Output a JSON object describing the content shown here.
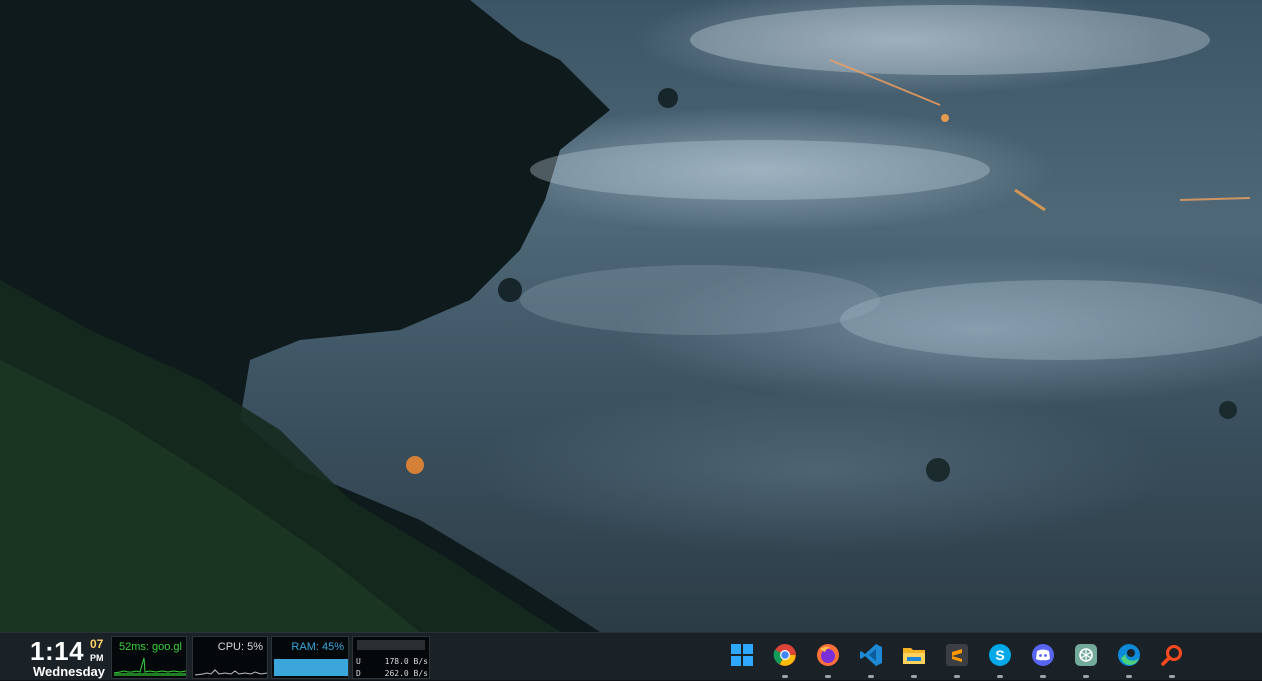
{
  "clock": {
    "hours_minutes": "1:14",
    "seconds": "07",
    "ampm": "PM",
    "day": "Wednesday"
  },
  "widgets": {
    "ping": {
      "label": "52ms: goo.gl",
      "color": "#39d23a"
    },
    "cpu": {
      "label": "CPU: 5%",
      "value_percent": 5,
      "color": "#d7dbde"
    },
    "ram": {
      "label": "RAM: 45%",
      "value_percent": 45,
      "color": "#3aa6dc"
    },
    "network": {
      "upload_label": "U",
      "upload_value": "178.0 B/s",
      "download_label": "D",
      "download_value": "262.0 B/s"
    }
  },
  "taskbar": {
    "apps": [
      {
        "name": "start",
        "icon": "windows-icon",
        "running": false
      },
      {
        "name": "chrome",
        "icon": "chrome-icon",
        "running": true
      },
      {
        "name": "firefox",
        "icon": "firefox-icon",
        "running": true
      },
      {
        "name": "vscode",
        "icon": "vscode-icon",
        "running": true
      },
      {
        "name": "file-explorer",
        "icon": "folder-icon",
        "running": true
      },
      {
        "name": "sublime-text",
        "icon": "sublime-icon",
        "running": true
      },
      {
        "name": "skype",
        "icon": "skype-icon",
        "running": true
      },
      {
        "name": "discord",
        "icon": "discord-icon",
        "running": true
      },
      {
        "name": "chatgpt",
        "icon": "openai-icon",
        "running": true
      },
      {
        "name": "edge",
        "icon": "edge-icon",
        "running": true
      },
      {
        "name": "search",
        "icon": "search-icon",
        "running": true
      }
    ]
  }
}
